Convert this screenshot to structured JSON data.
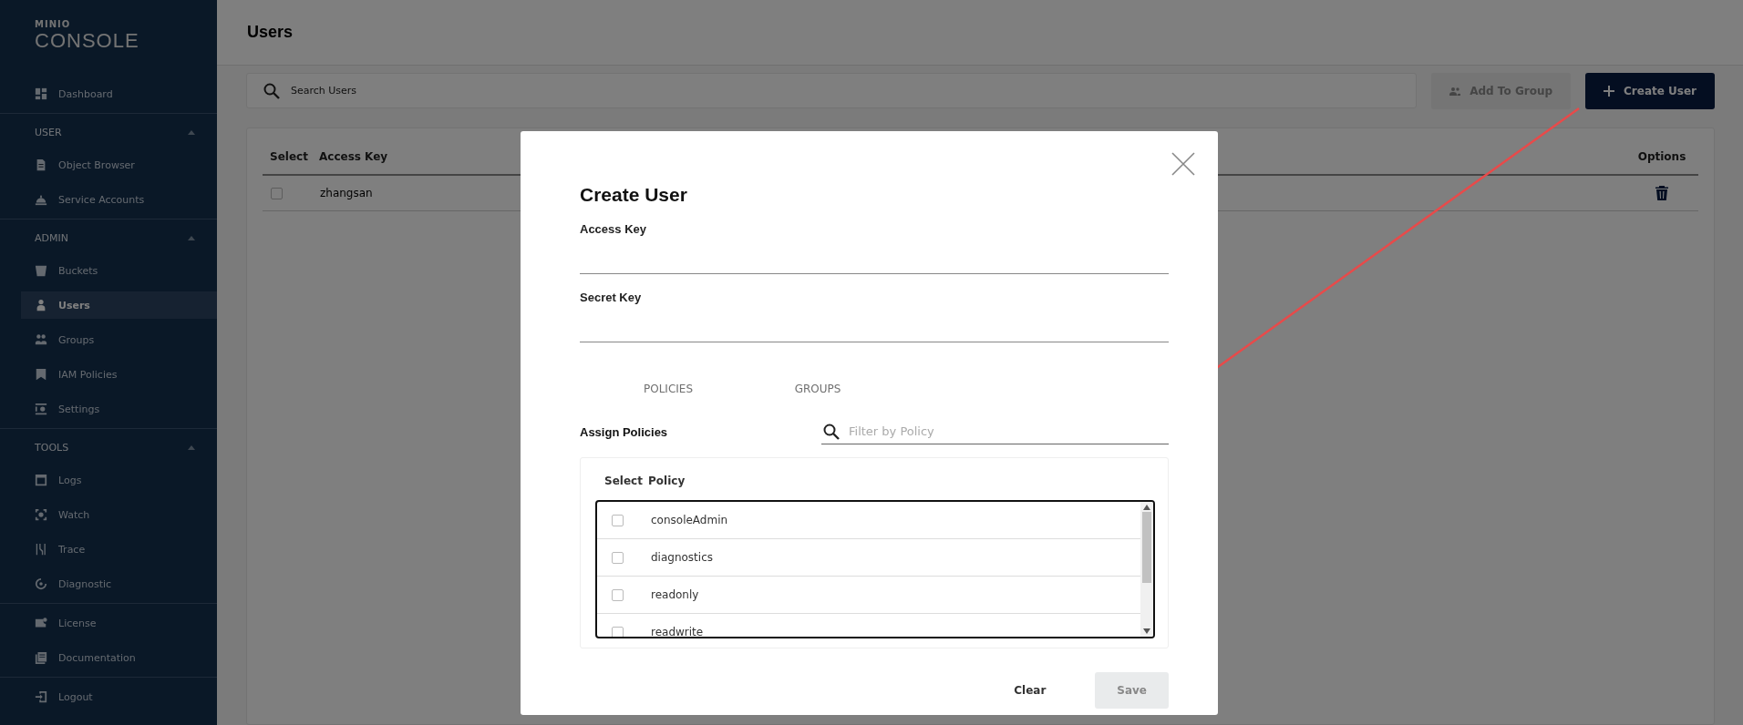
{
  "sidebar": {
    "logo": {
      "brand": "MINIO",
      "product": "CONSOLE"
    },
    "sections": [
      {
        "items": [
          {
            "label": "Dashboard",
            "selected": false
          }
        ]
      },
      {
        "title": "USER",
        "expanded": true,
        "items": [
          {
            "label": "Object Browser",
            "selected": false
          },
          {
            "label": "Service Accounts",
            "selected": false
          }
        ]
      },
      {
        "title": "ADMIN",
        "expanded": true,
        "items": [
          {
            "label": "Buckets",
            "selected": false
          },
          {
            "label": "Users",
            "selected": true
          },
          {
            "label": "Groups",
            "selected": false
          },
          {
            "label": "IAM Policies",
            "selected": false
          },
          {
            "label": "Settings",
            "selected": false
          }
        ]
      },
      {
        "title": "TOOLS",
        "expanded": true,
        "items": [
          {
            "label": "Logs",
            "selected": false
          },
          {
            "label": "Watch",
            "selected": false
          },
          {
            "label": "Trace",
            "selected": false
          },
          {
            "label": "Diagnostic",
            "selected": false
          }
        ]
      },
      {
        "items": [
          {
            "label": "License",
            "selected": false
          },
          {
            "label": "Documentation",
            "selected": false
          }
        ]
      },
      {
        "items": [
          {
            "label": "Logout",
            "selected": false
          }
        ]
      }
    ]
  },
  "main": {
    "title": "Users",
    "search": {
      "placeholder": "Search Users"
    },
    "buttons": [
      {
        "label": "Add To Group",
        "kind": "secondary",
        "disabled": true
      },
      {
        "label": "Create User",
        "kind": "primary"
      }
    ],
    "table": {
      "columns": [
        "Select",
        "Access Key",
        "Options"
      ],
      "rows": [
        {
          "access_key": "zhangsan",
          "checked": false
        }
      ]
    }
  },
  "modal": {
    "title": "Create User",
    "fields": [
      {
        "label": "Access Key"
      },
      {
        "label": "Secret Key"
      }
    ],
    "tabs": [
      {
        "label": "POLICIES"
      },
      {
        "label": "GROUPS"
      }
    ],
    "section_title": "Assign Policies",
    "filter": {
      "placeholder": "Filter by Policy"
    },
    "policy_table": {
      "columns": [
        "Select",
        "Policy"
      ],
      "rows": [
        {
          "policy": "consoleAdmin",
          "checked": false
        },
        {
          "policy": "diagnostics",
          "checked": false
        },
        {
          "policy": "readonly",
          "checked": false
        },
        {
          "policy": "readwrite",
          "checked": false
        }
      ]
    },
    "buttons": [
      {
        "label": "Clear",
        "kind": "text"
      },
      {
        "label": "Save",
        "kind": "contained",
        "disabled": true
      }
    ]
  }
}
